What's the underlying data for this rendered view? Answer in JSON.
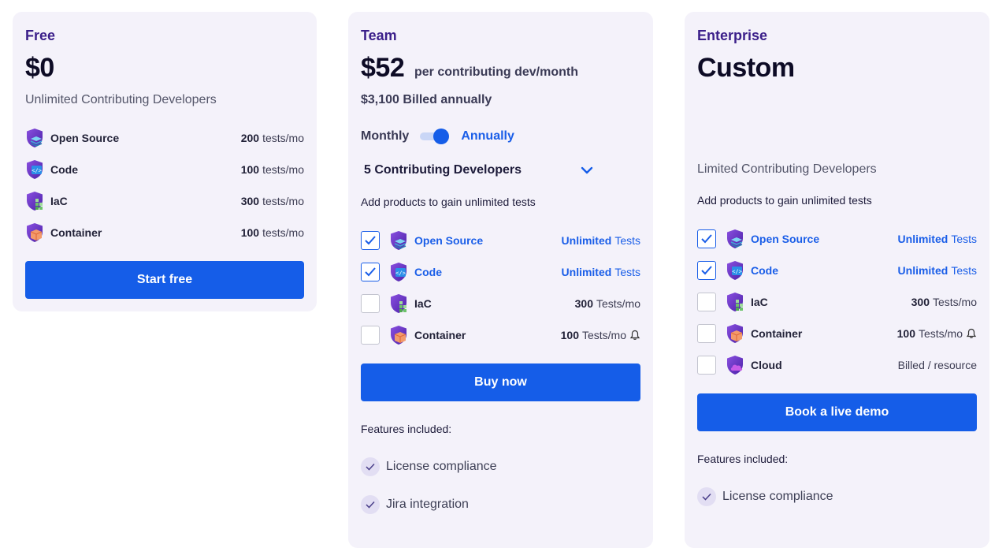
{
  "free": {
    "name": "Free",
    "price": "$0",
    "subtitle": "Unlimited Contributing Developers",
    "products": [
      {
        "name": "Open Source",
        "value": "200",
        "unit": "tests/mo",
        "icon": "open-source-icon"
      },
      {
        "name": "Code",
        "value": "100",
        "unit": "tests/mo",
        "icon": "code-icon"
      },
      {
        "name": "IaC",
        "value": "300",
        "unit": "tests/mo",
        "icon": "iac-icon"
      },
      {
        "name": "Container",
        "value": "100",
        "unit": "tests/mo",
        "icon": "container-icon"
      }
    ],
    "button": "Start free"
  },
  "team": {
    "name": "Team",
    "price": "$52",
    "price_unit": "per contributing dev/month",
    "billed": "$3,100 Billed annually",
    "toggle_left": "Monthly",
    "toggle_right": "Annually",
    "toggle_annual": true,
    "developers_selected": "5 Contributing Developers",
    "note": "Add products to gain unlimited tests",
    "products": [
      {
        "name": "Open Source",
        "value": "Unlimited",
        "unit": "Tests",
        "checked": true,
        "icon": "open-source-icon"
      },
      {
        "name": "Code",
        "value": "Unlimited",
        "unit": "Tests",
        "checked": true,
        "icon": "code-icon"
      },
      {
        "name": "IaC",
        "value": "300",
        "unit": "Tests/mo",
        "checked": false,
        "icon": "iac-icon"
      },
      {
        "name": "Container",
        "value": "100",
        "unit": "Tests/mo",
        "checked": false,
        "icon": "container-icon"
      }
    ],
    "button": "Buy now",
    "features_title": "Features included:",
    "features": [
      "License compliance",
      "Jira integration"
    ]
  },
  "enterprise": {
    "name": "Enterprise",
    "price": "Custom",
    "subtitle": "Limited Contributing Developers",
    "note": "Add products to gain unlimited tests",
    "products": [
      {
        "name": "Open Source",
        "value": "Unlimited",
        "unit": "Tests",
        "checked": true,
        "icon": "open-source-icon"
      },
      {
        "name": "Code",
        "value": "Unlimited",
        "unit": "Tests",
        "checked": true,
        "icon": "code-icon"
      },
      {
        "name": "IaC",
        "value": "300",
        "unit": "Tests/mo",
        "checked": false,
        "icon": "iac-icon"
      },
      {
        "name": "Container",
        "value": "100",
        "unit": "Tests/mo",
        "checked": false,
        "icon": "container-icon"
      },
      {
        "name": "Cloud",
        "value": "",
        "unit": "Billed / resource",
        "checked": false,
        "icon": "cloud-icon"
      }
    ],
    "button": "Book a live demo",
    "features_title": "Features included:",
    "features": [
      "License compliance"
    ]
  },
  "colors": {
    "accent": "#155de8",
    "card_bg": "#f4f2fa",
    "plan_name": "#3b1f8a",
    "shield": "#6f3bd1"
  }
}
